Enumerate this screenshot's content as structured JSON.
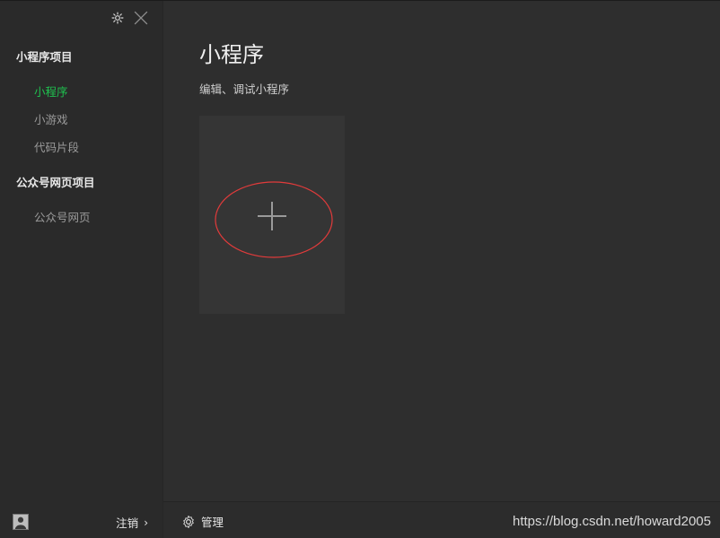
{
  "sidebar": {
    "sections": [
      {
        "title": "小程序项目",
        "items": [
          {
            "label": "小程序",
            "active": true
          },
          {
            "label": "小游戏",
            "active": false
          },
          {
            "label": "代码片段",
            "active": false
          }
        ]
      },
      {
        "title": "公众号网页项目",
        "items": [
          {
            "label": "公众号网页",
            "active": false
          }
        ]
      }
    ],
    "footer": {
      "logout_label": "注销",
      "chevron": "›"
    }
  },
  "main": {
    "title": "小程序",
    "subtitle": "编辑、调试小程序"
  },
  "footer": {
    "manage_label": "管理"
  },
  "watermark": "https://blog.csdn.net/howard2005",
  "colors": {
    "active": "#1fc24f",
    "annotation": "#e23b3b"
  },
  "icons": {
    "settings": "gear-icon",
    "close": "close-icon",
    "add": "plus-icon",
    "manage": "gear-icon",
    "avatar": "avatar"
  }
}
